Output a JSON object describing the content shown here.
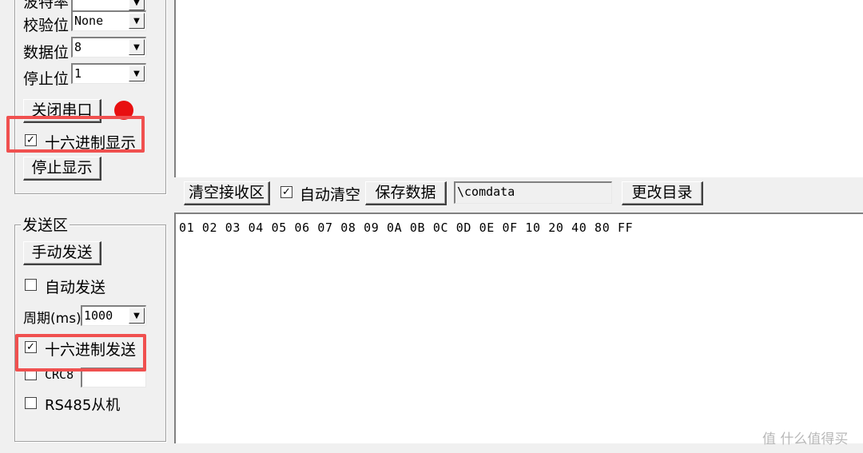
{
  "receive_settings": {
    "rows": [
      {
        "label": "波特率",
        "value": ""
      },
      {
        "label": "校验位",
        "value": "None"
      },
      {
        "label": "数据位",
        "value": "8"
      },
      {
        "label": "停止位",
        "value": "1"
      }
    ],
    "close_port_label": "关闭串口",
    "hex_display_label": "十六进制显示",
    "hex_display_checked": true,
    "stop_display_label": "停止显示",
    "status_color": "#e81010"
  },
  "receive_toolbar": {
    "clear_label": "清空接收区",
    "auto_clear_label": "自动清空",
    "auto_clear_checked": true,
    "save_label": "保存数据",
    "path_value": "\\comdata",
    "change_dir_label": "更改目录"
  },
  "send_area": {
    "title": "发送区",
    "manual_send_label": "手动发送",
    "auto_send_label": "自动发送",
    "period_label": "周期(ms)",
    "period_value": "1000",
    "hex_send_label": "十六进制发送",
    "hex_send_checked": true,
    "crc_label": "CRC8",
    "rs485_label": "RS485从机"
  },
  "send_content": "01 02 03 04 05 06 07 08 09 0A 0B 0C 0D 0E 0F 10 20 40 80 FF",
  "watermark": "值 什么值得买",
  "highlight_color": "#f0504f"
}
